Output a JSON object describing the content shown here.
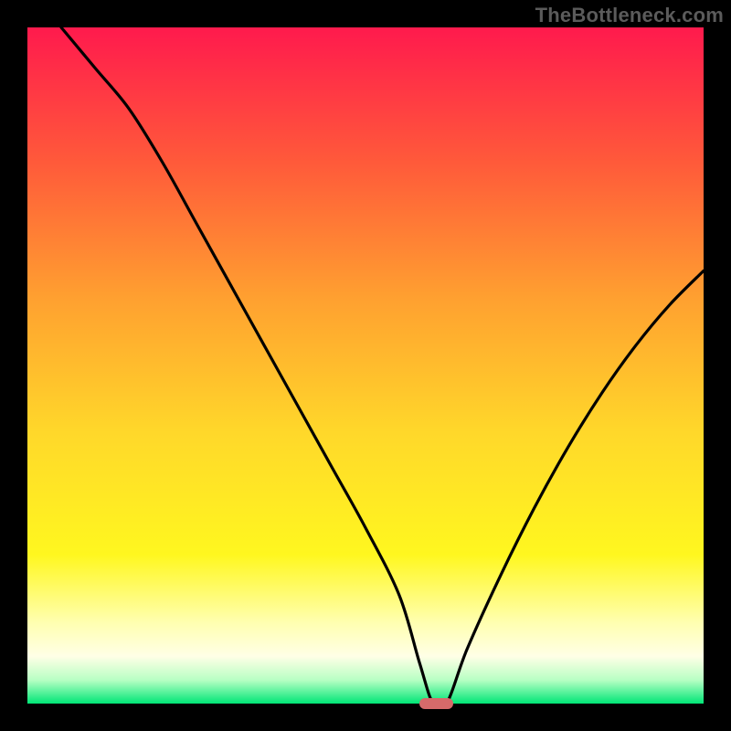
{
  "attribution": "TheBottleneck.com",
  "colors": {
    "frame": "#000000",
    "gradient_stops": [
      {
        "pos": 0.0,
        "color": "#ff1a4d"
      },
      {
        "pos": 0.2,
        "color": "#ff5a3a"
      },
      {
        "pos": 0.4,
        "color": "#ffa030"
      },
      {
        "pos": 0.6,
        "color": "#ffd82a"
      },
      {
        "pos": 0.78,
        "color": "#fff71f"
      },
      {
        "pos": 0.88,
        "color": "#ffffb0"
      },
      {
        "pos": 0.93,
        "color": "#ffffe6"
      },
      {
        "pos": 0.965,
        "color": "#b8ffc4"
      },
      {
        "pos": 1.0,
        "color": "#00e676"
      }
    ],
    "curve": "#000000",
    "marker": "#d66a6a"
  },
  "chart_data": {
    "type": "line",
    "title": "",
    "xlabel": "",
    "ylabel": "",
    "xlim": [
      0,
      100
    ],
    "ylim": [
      0,
      100
    ],
    "x": [
      5,
      10,
      15,
      20,
      25,
      30,
      35,
      40,
      45,
      50,
      55,
      58,
      60,
      62,
      65,
      70,
      75,
      80,
      85,
      90,
      95,
      100
    ],
    "y": [
      100,
      94,
      88,
      80,
      71,
      62,
      53,
      44,
      35,
      26,
      16,
      6,
      0,
      0,
      8,
      19,
      29,
      38,
      46,
      53,
      59,
      64
    ],
    "minimum_marker": {
      "x_start": 58,
      "x_end": 63,
      "y": 0
    },
    "notes": "Values in percent of axis range; curve starts at top-left, dips to zero near x≈60, rises toward right. Background is a vertical red→yellow→green gradient."
  }
}
